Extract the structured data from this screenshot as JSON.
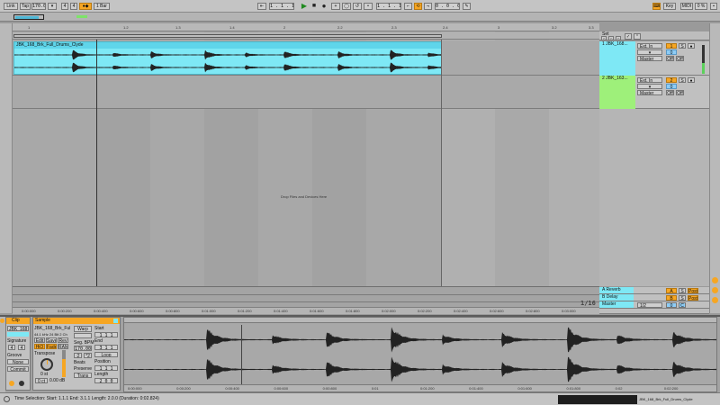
{
  "topbar": {
    "link": "Link",
    "tap": "Tap",
    "tempo": "170.00",
    "sig_num": "4",
    "sig_den": "4",
    "quant": "1 Bar",
    "position": [
      "1",
      "1",
      "1"
    ],
    "loop_start": [
      "1",
      "1",
      "1"
    ],
    "loop_len": [
      "0",
      "0",
      "0"
    ],
    "key": "Key",
    "midi": "MIDI",
    "cpu": "0 %",
    "overview_labels": [
      "Set"
    ]
  },
  "ruler": {
    "bars": [
      "1",
      "1.2",
      "1.3",
      "1.4",
      "2",
      "2.2",
      "2.3",
      "2.4",
      "3",
      "3.2",
      "3.3",
      "3.4"
    ]
  },
  "arrangement": {
    "clip_name": "JBK_168_Brk_Full_Drums_Clyde",
    "drop_text": "Drop Files and Devices Here",
    "page_indicator": "1/16",
    "time_labels": [
      "0:00:000",
      "0:00:200",
      "0:00:400",
      "0:00:600",
      "0:00:800",
      "0:01:000",
      "0:01:200",
      "0:01:400",
      "0:01:600",
      "0:01:800",
      "0:02:000",
      "0:02:200",
      "0:02:400",
      "0:02:600",
      "0:02:800",
      "0:03:000"
    ]
  },
  "tracks": [
    {
      "name": "1 JBK_168...",
      "input": "Ext. In",
      "channel": "1",
      "vol": "0",
      "pan": "S",
      "route": "Master",
      "off": "Off",
      "color": "#7ee8f5"
    },
    {
      "name": "2 JBK_163...",
      "input": "Ext. In",
      "channel": "2",
      "vol": "0",
      "pan": "S",
      "route": "Master",
      "off": "Off",
      "color": "#9ef07a"
    }
  ],
  "returns": [
    {
      "name": "A Reverb",
      "num": "A",
      "color": "#7ee8f5"
    },
    {
      "name": "B Delay",
      "num": "B",
      "color": "#7ee8f5"
    },
    {
      "name": "Master",
      "num": "1/2",
      "color": "#7ee8f5"
    }
  ],
  "clip_panel": {
    "title": "Clip",
    "clip_name": "JBK_168_Br",
    "signature_label": "Signature",
    "sig_num": "4",
    "sig_den": "4",
    "groove_label": "Groove",
    "groove_value": "None",
    "commit": "Commit",
    "orange_btn": "Ⓤ"
  },
  "sample_panel": {
    "title": "Sample",
    "file_name": "JBK_168_Brk_Full",
    "file_info": "44.1 kHz 24 Bit 2 Ch",
    "edit": "Edit",
    "save": "Save",
    "rev": "Rev",
    "hiq": "HiQ",
    "fade": "Fade",
    "ram": "RAM",
    "transpose_label": "Transpose",
    "transpose_value": "0 st",
    "detune": "0 ct",
    "gain": "0.00 dB",
    "warp": "Warp",
    "seg_bpm_label": "Seg. BPM",
    "seg_bpm": "170.00",
    "beats_label": "Beats",
    "preserve_label": "Preserve",
    "preserve_value": "Trans",
    "start_label": "Start",
    "start": [
      "1",
      "1",
      "1"
    ],
    "end_label": "End",
    "end": [
      "3",
      "1",
      "1"
    ],
    "loop_label": "Loop",
    "position_label": "Position",
    "position": [
      "1",
      "1",
      "1"
    ],
    "length_label": "Length",
    "length": [
      "2",
      "0",
      "0"
    ]
  },
  "detail_wave": {
    "time_labels": [
      "0:00:000",
      "0:00:200",
      "0:00:400",
      "0:00:600",
      "0:00:800",
      "0:01",
      "0:01:200",
      "0:01:400",
      "0:01:600",
      "0:01:800",
      "0:02",
      "0:02:200"
    ]
  },
  "statusbar": {
    "text": "Time Selection:   Start: 1.1.1   End: 3.1.1   Length: 2.0.0  (Duration: 0:02.824)",
    "right_clip": "JBK_168_Brk_Full_Drums_Clyde"
  }
}
